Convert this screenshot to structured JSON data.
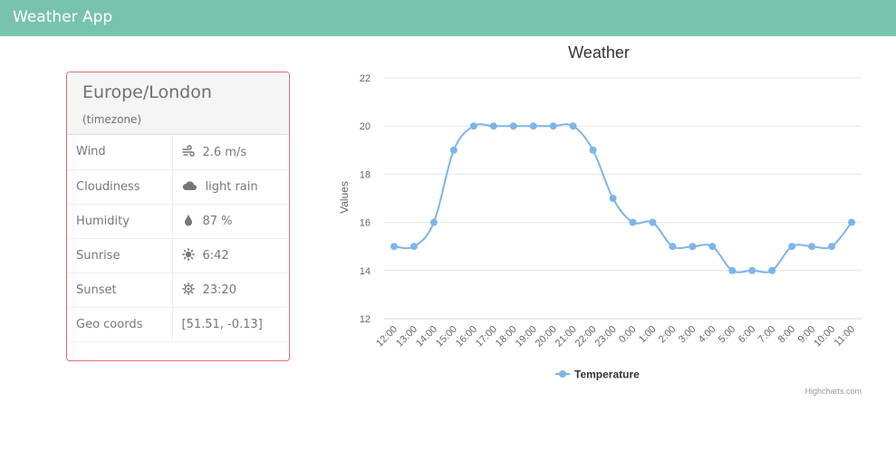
{
  "app": {
    "title": "Weather App"
  },
  "card": {
    "location": "Europe/London",
    "subtitle": "(timezone)",
    "rows": [
      {
        "key": "Wind",
        "icon": "wind-icon",
        "value": "2.6 m/s"
      },
      {
        "key": "Cloudiness",
        "icon": "cloud-icon",
        "value": "light rain"
      },
      {
        "key": "Humidity",
        "icon": "droplet-icon",
        "value": "87 %"
      },
      {
        "key": "Sunrise",
        "icon": "sun-icon",
        "value": "6:42"
      },
      {
        "key": "Sunset",
        "icon": "sunset-gear-icon",
        "value": "23:20"
      },
      {
        "key": "Geo coords",
        "icon": "",
        "value": "[51.51, -0.13]"
      }
    ]
  },
  "chart_data": {
    "type": "line",
    "title": "Weather",
    "ylabel": "Values",
    "xlabel": "",
    "ylim": [
      12,
      22
    ],
    "yticks": [
      12,
      14,
      16,
      18,
      20,
      22
    ],
    "grid": true,
    "legend_position": "bottom-center",
    "credits": "Highcharts.com",
    "categories": [
      "12:00",
      "13:00",
      "14:00",
      "15:00",
      "16:00",
      "17:00",
      "18:00",
      "19:00",
      "20:00",
      "21:00",
      "22:00",
      "23:00",
      "0:00",
      "1:00",
      "2:00",
      "3:00",
      "4:00",
      "5:00",
      "6:00",
      "7:00",
      "8:00",
      "9:00",
      "10:00",
      "11:00"
    ],
    "series": [
      {
        "name": "Temperature",
        "color": "#7cb5ec",
        "values": [
          15,
          15,
          16,
          19,
          20,
          20,
          20,
          20,
          20,
          20,
          19,
          17,
          16,
          16,
          15,
          15,
          15,
          14,
          14,
          14,
          15,
          15,
          15,
          16
        ]
      }
    ]
  }
}
